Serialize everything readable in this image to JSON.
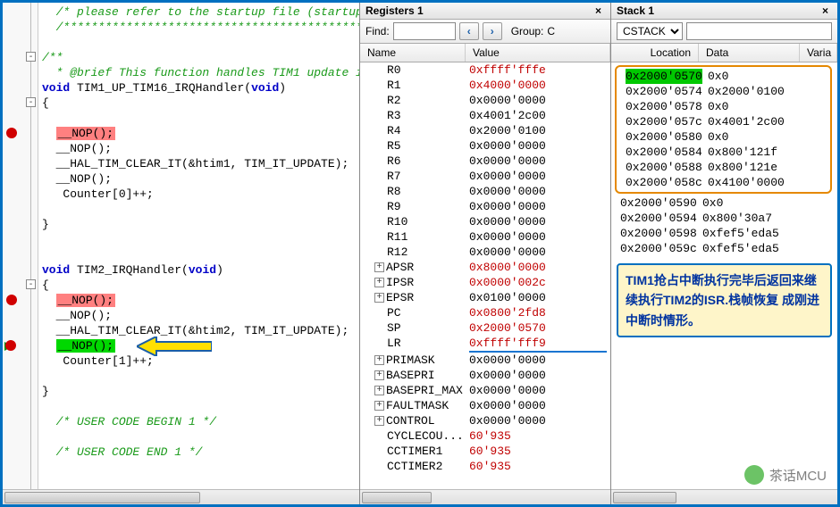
{
  "code": {
    "lines": [
      {
        "t": "cmt",
        "txt": "  /* please refer to the startup file (startup_s"
      },
      {
        "t": "cmt",
        "txt": "  /**********************************************"
      },
      {
        "t": "blank",
        "txt": ""
      },
      {
        "t": "cmt",
        "txt": "/**",
        "fold": true
      },
      {
        "t": "cmt",
        "txt": "  * @brief This function handles TIM1 update i"
      },
      {
        "t": "sig",
        "txt": "void TIM1_UP_TIM16_IRQHandler(void)"
      },
      {
        "t": "brace",
        "txt": "{",
        "fold": true
      },
      {
        "t": "blank",
        "txt": ""
      },
      {
        "t": "nop_red",
        "txt": "  __NOP();",
        "bp": true
      },
      {
        "t": "plain",
        "txt": "  __NOP();"
      },
      {
        "t": "plain",
        "txt": "  __HAL_TIM_CLEAR_IT(&htim1, TIM_IT_UPDATE);"
      },
      {
        "t": "plain",
        "txt": "  __NOP();"
      },
      {
        "t": "plain",
        "txt": "   Counter[0]++;"
      },
      {
        "t": "blank",
        "txt": ""
      },
      {
        "t": "brace",
        "txt": "}"
      },
      {
        "t": "blank",
        "txt": ""
      },
      {
        "t": "blank",
        "txt": ""
      },
      {
        "t": "sig",
        "txt": "void TIM2_IRQHandler(void)"
      },
      {
        "t": "brace",
        "txt": "{",
        "fold": true
      },
      {
        "t": "nop_red",
        "txt": "  __NOP();",
        "bp": true
      },
      {
        "t": "plain",
        "txt": "  __NOP();"
      },
      {
        "t": "plain",
        "txt": "  __HAL_TIM_CLEAR_IT(&htim2, TIM_IT_UPDATE);"
      },
      {
        "t": "nop_grn",
        "txt": "  __NOP();",
        "pc": true,
        "arrow": true
      },
      {
        "t": "plain",
        "txt": "   Counter[1]++;"
      },
      {
        "t": "blank",
        "txt": ""
      },
      {
        "t": "brace",
        "txt": "}"
      },
      {
        "t": "blank",
        "txt": ""
      },
      {
        "t": "cmt",
        "txt": "  /* USER CODE BEGIN 1 */"
      },
      {
        "t": "blank",
        "txt": ""
      },
      {
        "t": "cmt",
        "txt": "  /* USER CODE END 1 */"
      },
      {
        "t": "blank",
        "txt": ""
      }
    ]
  },
  "registers": {
    "title": "Registers 1",
    "find_label": "Find:",
    "group_label": "Group:",
    "group_value": "C",
    "cols": {
      "name": "Name",
      "value": "Value"
    },
    "rows": [
      {
        "n": "R0",
        "v": "0xffff'fffe",
        "red": true
      },
      {
        "n": "R1",
        "v": "0x4000'0000",
        "red": true
      },
      {
        "n": "R2",
        "v": "0x0000'0000"
      },
      {
        "n": "R3",
        "v": "0x4001'2c00"
      },
      {
        "n": "R4",
        "v": "0x2000'0100"
      },
      {
        "n": "R5",
        "v": "0x0000'0000"
      },
      {
        "n": "R6",
        "v": "0x0000'0000"
      },
      {
        "n": "R7",
        "v": "0x0000'0000"
      },
      {
        "n": "R8",
        "v": "0x0000'0000"
      },
      {
        "n": "R9",
        "v": "0x0000'0000"
      },
      {
        "n": "R10",
        "v": "0x0000'0000"
      },
      {
        "n": "R11",
        "v": "0x0000'0000"
      },
      {
        "n": "R12",
        "v": "0x0000'0000"
      },
      {
        "n": "APSR",
        "v": "0x8000'0000",
        "red": true,
        "exp": true
      },
      {
        "n": "IPSR",
        "v": "0x0000'002c",
        "red": true,
        "exp": true
      },
      {
        "n": "EPSR",
        "v": "0x0100'0000",
        "exp": true
      },
      {
        "n": "PC",
        "v": "0x0800'2fd8",
        "red": true
      },
      {
        "n": "SP",
        "v": "0x2000'0570",
        "red": true
      },
      {
        "n": "LR",
        "v": "0xffff'fff9",
        "red": true,
        "underline": true
      },
      {
        "n": "PRIMASK",
        "v": "0x0000'0000",
        "exp": true
      },
      {
        "n": "BASEPRI",
        "v": "0x0000'0000",
        "exp": true
      },
      {
        "n": "BASEPRI_MAX",
        "v": "0x0000'0000",
        "exp": true
      },
      {
        "n": "FAULTMASK",
        "v": "0x0000'0000",
        "exp": true
      },
      {
        "n": "CONTROL",
        "v": "0x0000'0000",
        "exp": true
      },
      {
        "n": "CYCLECOU...",
        "v": "60'935",
        "red": true
      },
      {
        "n": "CCTIMER1",
        "v": "60'935",
        "red": true
      },
      {
        "n": "CCTIMER2",
        "v": "60'935",
        "red": true
      }
    ]
  },
  "stack": {
    "title": "Stack 1",
    "select_value": "CSTACK",
    "cols": {
      "loc": "Location",
      "data": "Data",
      "varia": "Varia"
    },
    "hl_rows": [
      {
        "l": "0x2000'0570",
        "d": "0x0",
        "first": true
      },
      {
        "l": "0x2000'0574",
        "d": "0x2000'0100"
      },
      {
        "l": "0x2000'0578",
        "d": "0x0"
      },
      {
        "l": "0x2000'057c",
        "d": "0x4001'2c00"
      },
      {
        "l": "0x2000'0580",
        "d": "0x0"
      },
      {
        "l": "0x2000'0584",
        "d": "0x800'121f"
      },
      {
        "l": "0x2000'0588",
        "d": "0x800'121e"
      },
      {
        "l": "0x2000'058c",
        "d": "0x4100'0000"
      }
    ],
    "rows": [
      {
        "l": "0x2000'0590",
        "d": "0x0"
      },
      {
        "l": "0x2000'0594",
        "d": "0x800'30a7"
      },
      {
        "l": "0x2000'0598",
        "d": "0xfef5'eda5"
      },
      {
        "l": "0x2000'059c",
        "d": "0xfef5'eda5"
      }
    ],
    "annotation": "TIM1抢占中断执行完毕后返回来继续执行TIM2的ISR.栈帧恢复 成刚进中断时情形。"
  },
  "watermark": "茶话MCU"
}
